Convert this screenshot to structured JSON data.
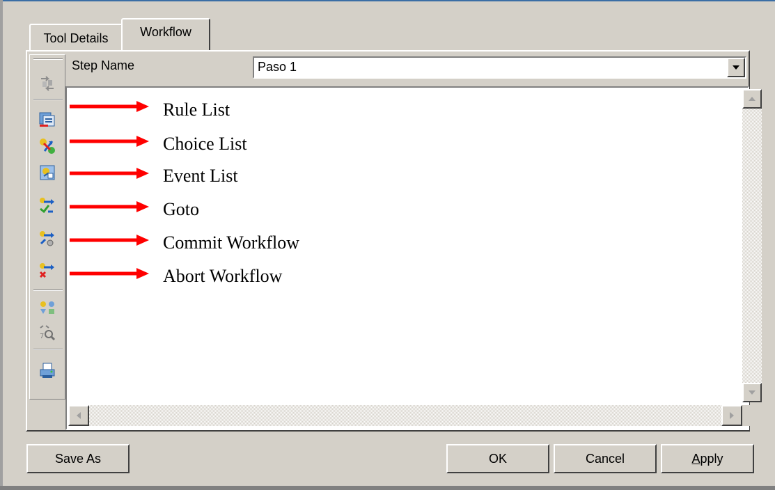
{
  "tabs": [
    {
      "label": "Tool Details"
    },
    {
      "label": "Workflow"
    }
  ],
  "step": {
    "label": "Step Name",
    "value": "Paso 1"
  },
  "toolbar": {
    "icons": [
      "add-step-icon",
      "rule-list-icon",
      "choice-list-icon",
      "event-list-icon",
      "goto-icon",
      "commit-workflow-icon",
      "abort-workflow-icon",
      "shapes-icon",
      "zoom-icon",
      "print-icon"
    ]
  },
  "annotations": [
    "Rule List",
    "Choice List",
    "Event List",
    "Goto",
    "Commit Workflow",
    "Abort Workflow"
  ],
  "buttons": {
    "save_as": "Save As",
    "ok": "OK",
    "cancel": "Cancel",
    "apply_first": "A",
    "apply_rest": "pply"
  },
  "colors": {
    "arrow": "#ff0000",
    "dialog_bg": "#d4d0c8"
  }
}
